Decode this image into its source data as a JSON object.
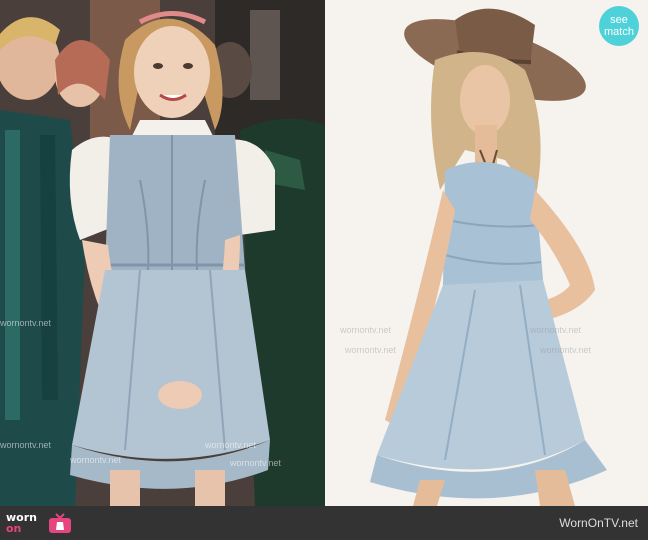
{
  "watermarks": {
    "left_repeat": "wornontv.net",
    "right_repeat": "wornontv.net"
  },
  "badge": {
    "line1": "see",
    "line2": "match"
  },
  "footer": {
    "logo_line1": "worn",
    "logo_line2": "on",
    "credit": "WornOnTV.net"
  },
  "colors": {
    "footer_bg": "#333333",
    "badge_bg": "#4fd1d9",
    "logo_accent": "#e5467f"
  }
}
